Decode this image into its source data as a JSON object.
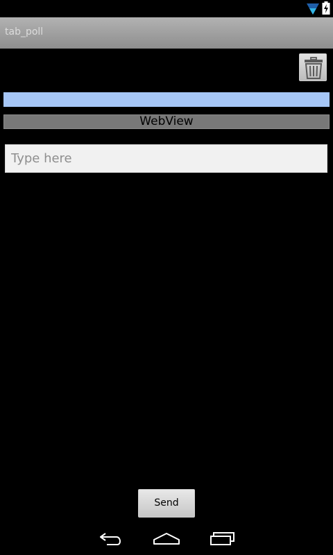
{
  "status_bar": {
    "icons": [
      "wifi-icon",
      "battery-charging-icon"
    ],
    "wifi_color": "#33b5e5"
  },
  "title_bar": {
    "title": "tab_poll"
  },
  "toolbar": {
    "delete_icon": "trash-icon"
  },
  "webview": {
    "label": "WebView"
  },
  "message_input": {
    "value": "",
    "placeholder": "Type here"
  },
  "send_button": {
    "label": "Send"
  },
  "nav_bar": {
    "icons": [
      "back-icon",
      "home-icon",
      "recent-apps-icon"
    ]
  },
  "colors": {
    "background": "#000000",
    "blue_bar": "#a6c6f6",
    "webview_bg": "#787878"
  }
}
